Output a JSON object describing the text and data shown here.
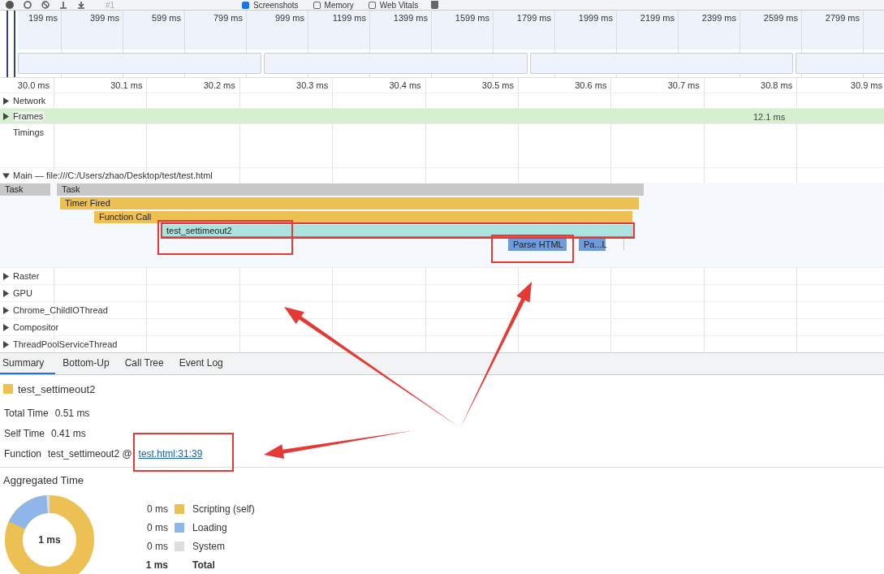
{
  "toolbar": {
    "recording": {
      "label": "#1",
      "disabled": true
    },
    "checkboxes": [
      {
        "label": "Screenshots",
        "checked": true
      },
      {
        "label": "Memory",
        "checked": false
      },
      {
        "label": "Web Vitals",
        "checked": false
      }
    ]
  },
  "overview": {
    "ticks": [
      "199 ms",
      "399 ms",
      "599 ms",
      "799 ms",
      "999 ms",
      "1199 ms",
      "1399 ms",
      "1599 ms",
      "1799 ms",
      "1999 ms",
      "2199 ms",
      "2399 ms",
      "2599 ms",
      "2799 ms"
    ]
  },
  "ruler": {
    "ticks": [
      "30.0 ms",
      "30.1 ms",
      "30.2 ms",
      "30.3 ms",
      "30.4 ms",
      "30.5 ms",
      "30.6 ms",
      "30.7 ms",
      "30.8 ms",
      "30.9 ms"
    ]
  },
  "tracks": [
    {
      "label": "Network",
      "kind": "collapsible",
      "expanded": false
    },
    {
      "label": "Frames",
      "kind": "frames",
      "expanded": false,
      "frame_time": "12.1 ms"
    },
    {
      "label": "Timings",
      "kind": "plain"
    }
  ],
  "main": {
    "label": "Main — file:///C:/Users/zhao/Desktop/test/test.html",
    "expanded": true,
    "events": [
      {
        "label": "Task",
        "color": "#c8c8c8",
        "selected": false
      },
      {
        "label": "Task",
        "color": "#c8c8c8",
        "selected": false
      },
      {
        "label": "Timer Fired",
        "color": "#ecc052",
        "selected": false
      },
      {
        "label": "Function Call",
        "color": "#ecc052",
        "selected": false
      },
      {
        "label": "test_settimeout2",
        "color": "#ace3de",
        "selected": true
      },
      {
        "label": "Parse HTML",
        "color": "#6e9bd9",
        "selected": false
      },
      {
        "label": "Pa...L",
        "color": "#6e9bd9",
        "selected": false
      }
    ]
  },
  "threads": [
    {
      "label": "Raster",
      "expanded": false
    },
    {
      "label": "GPU",
      "expanded": false
    },
    {
      "label": "Chrome_ChildIOThread",
      "expanded": false
    },
    {
      "label": "Compositor",
      "expanded": false
    },
    {
      "label": "ThreadPoolServiceThread",
      "expanded": false
    }
  ],
  "details": {
    "tabs": [
      {
        "label": "Summary",
        "selected": true
      },
      {
        "label": "Bottom-Up",
        "selected": false
      },
      {
        "label": "Call Tree",
        "selected": false
      },
      {
        "label": "Event Log",
        "selected": false
      }
    ],
    "title": {
      "label": "test_settimeout2",
      "color": "#ecc052"
    },
    "rows": [
      {
        "label": "Total Time",
        "value": "0.51 ms"
      },
      {
        "label": "Self Time",
        "value": "0.41 ms"
      },
      {
        "label": "Function",
        "value": "test_settimeout2 @",
        "link": "test.html:31:39"
      }
    ],
    "aggregated": {
      "title": "Aggregated Time",
      "center": "1 ms",
      "legend": [
        {
          "value": "0 ms",
          "label": "Scripting (self)",
          "color": "#ecc052",
          "kind": "item"
        },
        {
          "value": "0 ms",
          "label": "Loading",
          "color": "#8fb6e8",
          "kind": "item"
        },
        {
          "value": "0 ms",
          "label": "System",
          "color": "#dddddd",
          "kind": "item"
        },
        {
          "value": "1 ms",
          "label": "Total",
          "kind": "total"
        }
      ]
    }
  }
}
